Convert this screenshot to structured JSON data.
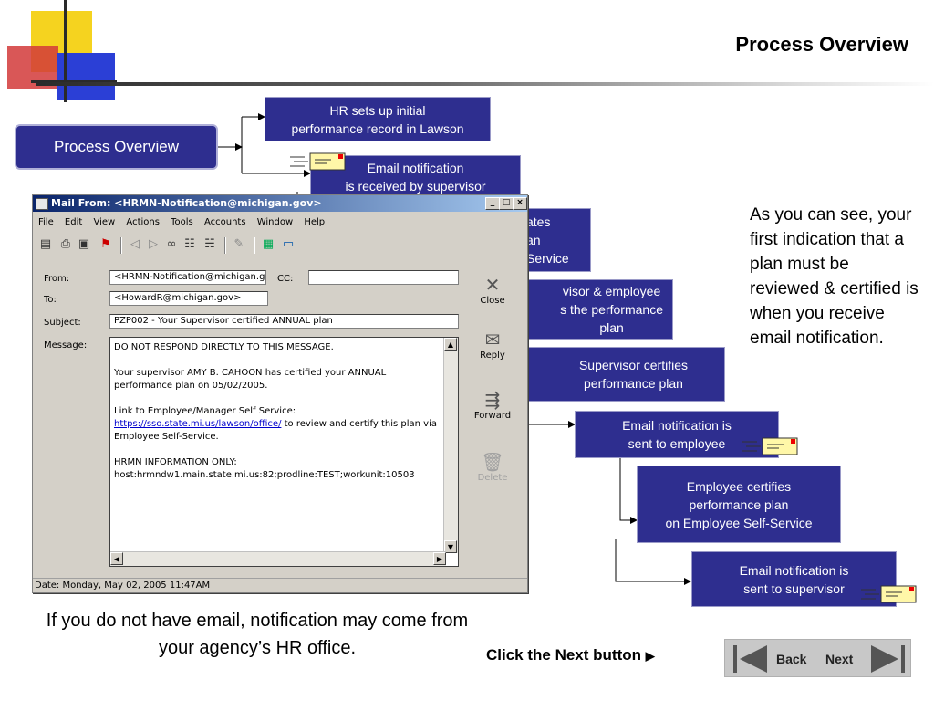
{
  "title": "Process Overview",
  "colors": {
    "box_fill": "#2e2e8f",
    "deco_yellow": "#f5d31f",
    "deco_red": "#c8102e",
    "deco_blue": "#2b3fd6"
  },
  "flow": {
    "main": "Process Overview",
    "step1": "HR sets up initial\nperformance record in Lawson",
    "step2": "Email notification\nis received by supervisor",
    "step3": "ates\nan\nService",
    "step4": "visor & employee\ns the performance\nplan",
    "step5": "Supervisor certifies\nperformance plan",
    "step6": "Email notification is\nsent to employee",
    "step7": "Employee certifies\nperformance plan\non Employee Self-Service",
    "step8": "Email notification is\nsent to supervisor",
    "envelope_icon": "envelope-icon"
  },
  "mail": {
    "window_title": "Mail From: <HRMN-Notification@michigan.gov>",
    "menu": [
      "File",
      "Edit",
      "View",
      "Actions",
      "Tools",
      "Accounts",
      "Window",
      "Help"
    ],
    "from_label": "From:",
    "from_value": "<HRMN-Notification@michigan.gov>",
    "cc_label": "CC:",
    "cc_value": "",
    "to_label": "To:",
    "to_value": "<HowardR@michigan.gov>",
    "subject_label": "Subject:",
    "subject_value": "PZP002 - Your Supervisor certified ANNUAL plan",
    "message_label": "Message:",
    "message": {
      "line1": "DO NOT RESPOND DIRECTLY TO THIS MESSAGE.",
      "para2": "Your supervisor AMY B. CAHOON has certified your ANNUAL performance plan on 05/02/2005.",
      "link_intro": "Link to Employee/Manager Self Service:",
      "link": "https://sso.state.mi.us/lawson/office/",
      "link_after": " to review and certify this plan via Employee Self-Service.",
      "info_head": "HRMN INFORMATION ONLY:",
      "info": "host:hrmndw1.main.state.mi.us:82;prodline:TEST;workunit:10503"
    },
    "actions": {
      "close": "Close",
      "reply": "Reply",
      "forward": "Forward",
      "delete": "Delete"
    },
    "status": "Date: Monday, May 02, 2005 11:47AM"
  },
  "right_text": "As you can see, your first indication that a plan must be reviewed & certified is when you receive email notification.",
  "bottom_text": "If you do not have email, notification may come from your agency’s HR office.",
  "nav": {
    "hint": "Click the Next button",
    "back": "Back",
    "next": "Next"
  }
}
